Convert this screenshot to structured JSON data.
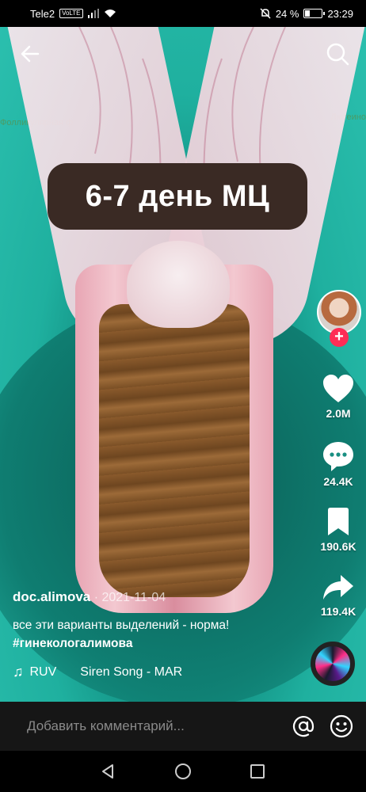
{
  "status_bar": {
    "carrier": "Tele2",
    "volte": "VoLTE",
    "battery": "24 %",
    "battery_level": 0.24,
    "time": "23:29"
  },
  "video": {
    "caption": "6-7 день МЦ",
    "blurred_left": "Фолликулярная ф",
    "blurred_right": "Лютеино"
  },
  "nav": {
    "back_icon": "arrow-left-icon",
    "search_icon": "search-icon"
  },
  "rail": {
    "likes": "2.0M",
    "comments": "24.4K",
    "saves": "190.6K",
    "shares": "119.4K"
  },
  "post": {
    "author": "doc.alimova",
    "separator": " · ",
    "date": "2021-11-04",
    "description": "все эти варианты выделений - норма! ",
    "hashtag": "#гинекологалимова",
    "music_artist": "RUV",
    "music_title": "Siren Song - MAR"
  },
  "comment_bar": {
    "placeholder": "Добавить комментарий..."
  },
  "colors": {
    "accent": "#fe2c55",
    "caption_bg": "#3a2a24",
    "video_bg": "#1fb09f"
  }
}
